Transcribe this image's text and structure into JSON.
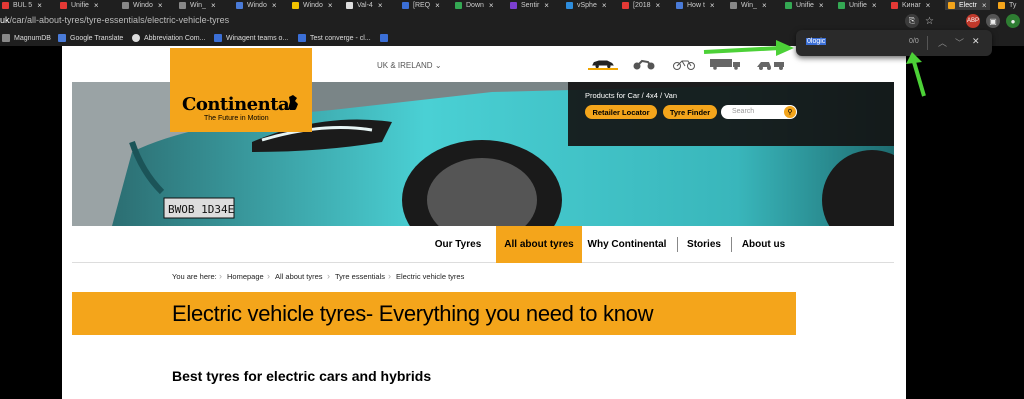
{
  "tabs": [
    {
      "label": "BUL 5",
      "color": "#e53935"
    },
    {
      "label": "Unifie",
      "color": "#e53935"
    },
    {
      "label": "Windo",
      "color": "#888888"
    },
    {
      "label": "Win_",
      "color": "#888888"
    },
    {
      "label": "Windo",
      "color": "#4a7bd8"
    },
    {
      "label": "Windo",
      "color": "#f2c200"
    },
    {
      "label": "Val-4",
      "color": "#dddddd"
    },
    {
      "label": "[REQ",
      "color": "#3b6fd6"
    },
    {
      "label": "Down",
      "color": "#34a853"
    },
    {
      "label": "Sentir",
      "color": "#7b3fd0"
    },
    {
      "label": "vSphe",
      "color": "#2d8cdb"
    },
    {
      "label": "[2018",
      "color": "#e53935"
    },
    {
      "label": "How t",
      "color": "#4a7bd8"
    },
    {
      "label": "Win_",
      "color": "#888888"
    },
    {
      "label": "Unifie",
      "color": "#34a853"
    },
    {
      "label": "Unifie",
      "color": "#34a853"
    },
    {
      "label": "Kинаr",
      "color": "#e53935"
    },
    {
      "label": "Electr",
      "color": "#f4a51b"
    },
    {
      "label": "Ty",
      "color": "#f4a51b"
    }
  ],
  "url": {
    "host": "uk",
    "path": "/car/all-about-tyres/tyre-essentials/electric-vehicle-tyres"
  },
  "bookmarks": [
    {
      "label": "MagnumDB",
      "color": "#888888"
    },
    {
      "label": "Google Translate",
      "color": "#4a7bd8"
    },
    {
      "label": "Abbreviation Com...",
      "color": "#dddddd"
    },
    {
      "label": "Winagent teams o...",
      "color": "#3b6fd6"
    },
    {
      "label": "Test converge - cl...",
      "color": "#3b6fd6"
    },
    {
      "label": "",
      "color": "#3b6fd6"
    }
  ],
  "find": {
    "query": "0logic",
    "count": "0/0"
  },
  "site": {
    "region": "UK & IRELAND",
    "vehicle_icons": [
      "car-icon",
      "motorcycle-icon",
      "bicycle-icon",
      "truck-icon",
      "industrial-icon"
    ],
    "logo": "Continental",
    "logo_tagline": "The Future in Motion",
    "products_title": "Products for Car / 4x4 / Van",
    "retailer_locator": "Retailer Locator",
    "tyre_finder": "Tyre Finder",
    "search_placeholder": "Search",
    "nav": [
      "Our Tyres",
      "All about tyres",
      "Why Continental",
      "Stories",
      "About us"
    ],
    "breadcrumb_prefix": "You are here:",
    "breadcrumb": [
      "Homepage",
      "All about tyres",
      "Tyre essentials",
      "Electric vehicle tyres"
    ],
    "title": "Electric vehicle tyres- Everything you need to know",
    "subheading": "Best tyres for electric cars and hybrids",
    "plate": "BWOB 1D34E"
  },
  "colors": {
    "accent": "#f4a51b",
    "annotation": "#4cd137"
  }
}
